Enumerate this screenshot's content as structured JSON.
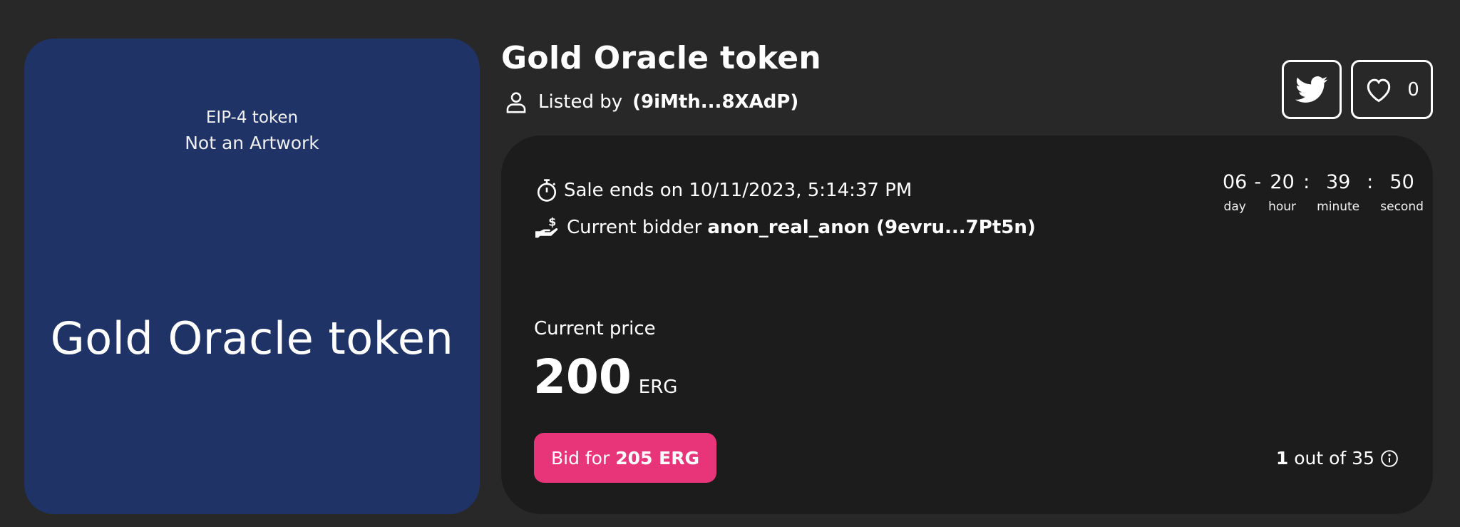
{
  "artwork": {
    "token_type": "EIP-4 token",
    "artwork_note": "Not an Artwork",
    "display_name": "Gold Oracle token",
    "background_color": "#1f3366"
  },
  "header": {
    "title": "Gold Oracle token",
    "listed_by_label": "Listed by",
    "listed_by_address": "(9iMth...8XAdP)"
  },
  "actions": {
    "share_icon": "twitter-icon",
    "like_icon": "heart-icon",
    "like_count": "0"
  },
  "auction": {
    "sale_ends_label": "Sale ends on 10/11/2023, 5:14:37 PM",
    "bidder_label": "Current bidder",
    "bidder_name": "anon_real_anon (9evru...7Pt5n)",
    "countdown": [
      {
        "value": "06",
        "unit": "day"
      },
      {
        "value": "20",
        "unit": "hour"
      },
      {
        "value": "39",
        "unit": "minute"
      },
      {
        "value": "50",
        "unit": "second"
      }
    ],
    "countdown_separators": [
      "-",
      ":",
      ":"
    ],
    "current_price_label": "Current price",
    "price_amount": "200",
    "price_currency": "ERG",
    "bid_button_prefix": "Bid for",
    "bid_button_amount": "205 ERG",
    "supply_index": "1",
    "supply_text": "out of 35",
    "accent_color": "#e8357a"
  }
}
